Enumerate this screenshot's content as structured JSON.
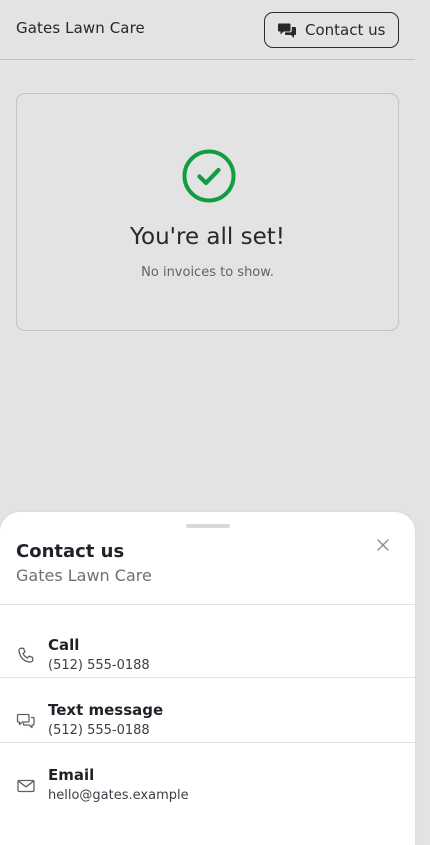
{
  "header": {
    "brand": "Gates Lawn Care",
    "contact_button": "Contact us"
  },
  "status_card": {
    "title": "You're all set!",
    "subtitle": "No invoices to show."
  },
  "sheet": {
    "title": "Contact us",
    "subtitle": "Gates Lawn Care",
    "options": [
      {
        "label": "Call",
        "value": "(512) 555-0188",
        "icon": "phone-icon"
      },
      {
        "label": "Text message",
        "value": "(512) 555-0188",
        "icon": "chat-icon"
      },
      {
        "label": "Email",
        "value": "hello@gates.example",
        "icon": "mail-icon"
      }
    ]
  },
  "colors": {
    "success": "#12b04a",
    "text": "#1f2328",
    "muted": "#6b7078",
    "border": "#d9dbde"
  }
}
